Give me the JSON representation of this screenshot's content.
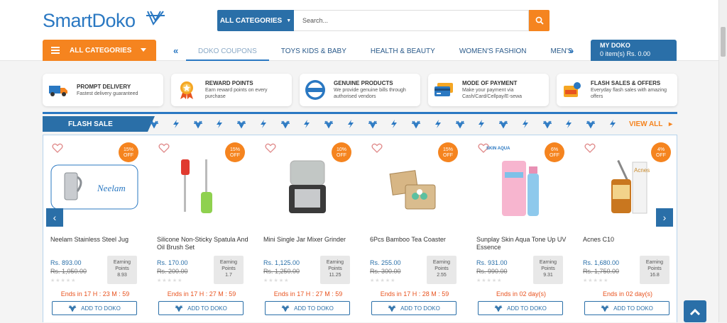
{
  "brand": {
    "name_part1": "Smart",
    "name_part2": "Doko"
  },
  "search": {
    "category_label": "ALL CATEGORIES",
    "placeholder": "Search..."
  },
  "nav": {
    "all_categories_label": "ALL CATEGORIES",
    "tabs": [
      {
        "label": "DOKO COUPONS"
      },
      {
        "label": "TOYS KIDS & BABY"
      },
      {
        "label": "HEALTH & BEAUTY"
      },
      {
        "label": "WOMEN'S FASHION"
      },
      {
        "label": "MEN'S FA"
      }
    ],
    "prev_arrow": "«",
    "next_arrow": "»"
  },
  "cart": {
    "title": "MY DOKO",
    "summary": "0 item(s) Rs. 0.00"
  },
  "features": [
    {
      "title": "PROMPT DELIVERY",
      "desc": "Fastest delivery guaranteed",
      "icon": "truck-icon"
    },
    {
      "title": "REWARD POINTS",
      "desc": "Earn reward points on every purchase",
      "icon": "medal-icon"
    },
    {
      "title": "GENUINE PRODUCTS",
      "desc": "We provide genuine bills through authorised vendors",
      "icon": "genuine-seal-icon"
    },
    {
      "title": "MODE OF PAYMENT",
      "desc": "Make your payment via Cash/Card/Cellpay/E-sewa",
      "icon": "credit-card-icon"
    },
    {
      "title": "FLASH SALES & OFFERS",
      "desc": "Everyday flash sales with amazing offers",
      "icon": "sale-tag-icon"
    }
  ],
  "flash_sale": {
    "label": "FLASH SALE",
    "view_all": "VIEW ALL"
  },
  "products": [
    {
      "name": "Neelam Stainless Steel Jug",
      "discount": "15%",
      "off": "OFF",
      "price": "Rs. 893.00",
      "old_price": "Rs. 1,050.00",
      "earn_label_1": "Earning",
      "earn_label_2": "Points",
      "points": "8.93",
      "ends": "Ends in 17 H : 23 M : 59",
      "add_label": "ADD TO DOKO"
    },
    {
      "name": "Silicone Non-Sticky Spatula And Oil Brush Set",
      "discount": "15%",
      "off": "OFF",
      "price": "Rs. 170.00",
      "old_price": "Rs. 200.00",
      "earn_label_1": "Earning",
      "earn_label_2": "Points",
      "points": "1.7",
      "ends": "Ends in 17 H : 27 M : 59",
      "add_label": "ADD TO DOKO"
    },
    {
      "name": "Mini Single Jar Mixer Grinder",
      "discount": "10%",
      "off": "OFF",
      "price": "Rs. 1,125.00",
      "old_price": "Rs. 1,250.00",
      "earn_label_1": "Earning",
      "earn_label_2": "Points",
      "points": "11.25",
      "ends": "Ends in 17 H : 27 M : 59",
      "add_label": "ADD TO DOKO"
    },
    {
      "name": "6Pcs Bamboo Tea Coaster",
      "discount": "15%",
      "off": "OFF",
      "price": "Rs. 255.00",
      "old_price": "Rs. 300.00",
      "earn_label_1": "Earning",
      "earn_label_2": "Points",
      "points": "2.55",
      "ends": "Ends in 17 H : 28 M : 59",
      "add_label": "ADD TO DOKO"
    },
    {
      "name": "Sunplay Skin Aqua Tone Up UV Essence",
      "discount": "6%",
      "off": "OFF",
      "price": "Rs. 931.00",
      "old_price": "Rs. 990.00",
      "earn_label_1": "Earning",
      "earn_label_2": "Points",
      "points": "9.31",
      "ends": "Ends in 02 day(s)",
      "add_label": "ADD TO DOKO"
    },
    {
      "name": "Acnes C10",
      "discount": "4%",
      "off": "OFF",
      "price": "Rs. 1,680.00",
      "old_price": "Rs. 1,750.00",
      "earn_label_1": "Earning",
      "earn_label_2": "Points",
      "points": "16.8",
      "ends": "Ends in 02 day(s)",
      "add_label": "ADD TO DOKO"
    }
  ],
  "brand_marks": {
    "neelam": "Neelam",
    "skin_aqua": "SKIN AQUA",
    "acnes": "Acnes"
  },
  "colors": {
    "primary": "#2a6fa8",
    "accent": "#f5841f",
    "timer": "#e8531f"
  }
}
